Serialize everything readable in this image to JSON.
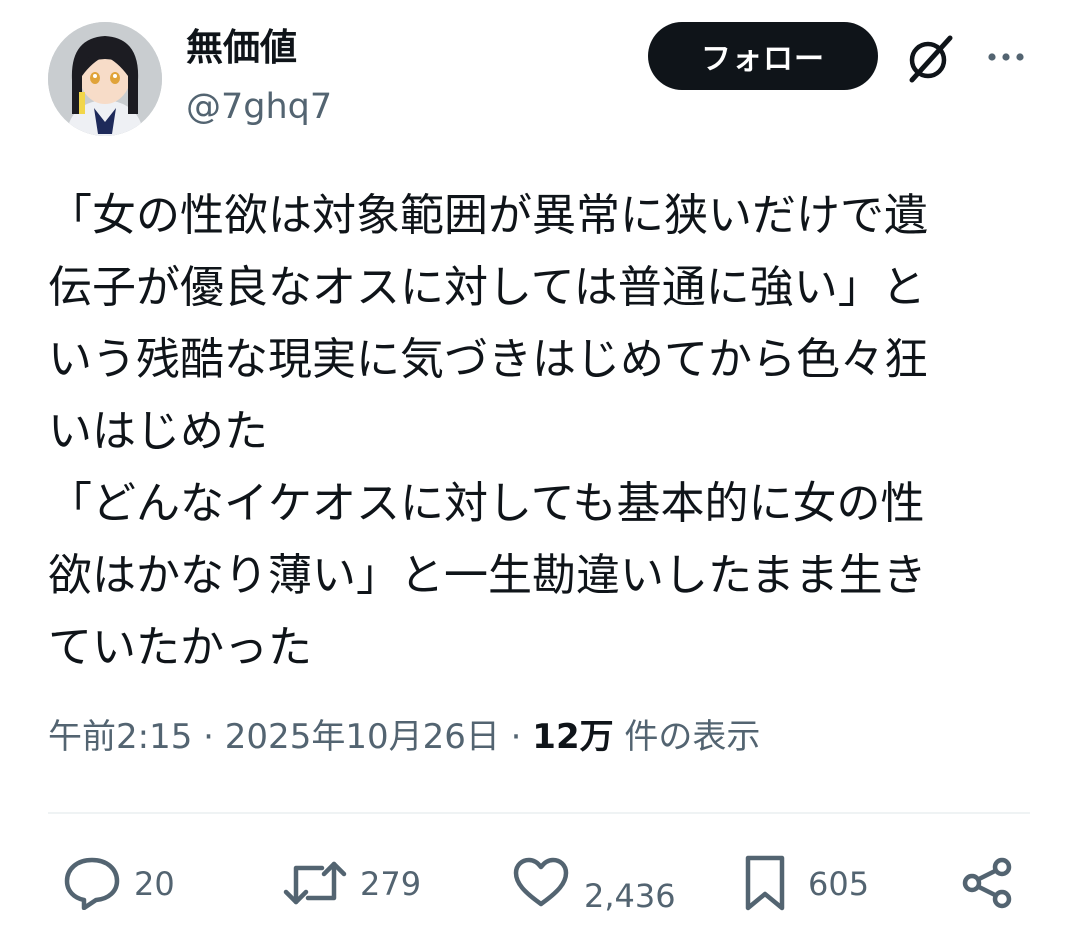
{
  "author": {
    "display_name": "無価値",
    "handle": "@7ghq7",
    "avatar_icon": "anime-girl-avatar"
  },
  "header": {
    "follow_label": "フォロー",
    "grok_icon": "grok-icon",
    "more_icon": "more-icon"
  },
  "tweet": {
    "text": "「女の性欲は対象範囲が異常に狭いだけで遺\n伝子が優良なオスに対しては普通に強い」と\nいう残酷な現実に気づきはじめてから色々狂\nいはじめた\n「どんなイケオスに対しても基本的に女の性\n欲はかなり薄い」と一生勘違いしたまま生き\nていたかった"
  },
  "meta": {
    "time": "午前2:15",
    "separator": " · ",
    "date": "2025年10月26日",
    "views_count": "12万",
    "views_label": " 件の表示"
  },
  "actions": {
    "replies": "20",
    "reposts": "279",
    "likes": "2,436",
    "bookmarks": "605"
  },
  "colors": {
    "text": "#0f1419",
    "secondary": "#536471",
    "button_bg": "#0f1419",
    "divider": "#eff3f4"
  }
}
